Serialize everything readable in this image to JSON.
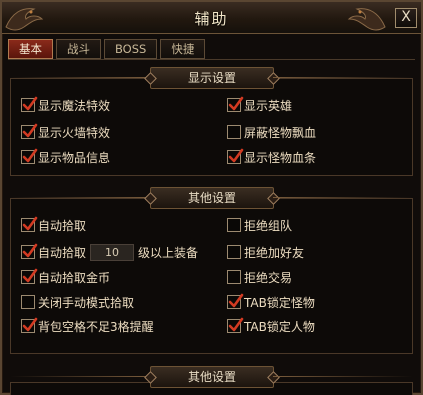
{
  "window": {
    "title": "辅助",
    "close_label": "X"
  },
  "tabs": [
    {
      "label": "基本",
      "active": true
    },
    {
      "label": "战斗",
      "active": false
    },
    {
      "label": "BOSS",
      "active": false
    },
    {
      "label": "快捷",
      "active": false
    }
  ],
  "display_settings": {
    "header": "显示设置",
    "options": [
      {
        "label": "显示魔法特效",
        "checked": true
      },
      {
        "label": "显示英雄",
        "checked": true
      },
      {
        "label": "显示火墙特效",
        "checked": true
      },
      {
        "label": "屏蔽怪物飘血",
        "checked": false
      },
      {
        "label": "显示物品信息",
        "checked": true
      },
      {
        "label": "显示怪物血条",
        "checked": true
      }
    ]
  },
  "other_settings": {
    "header": "其他设置",
    "options": [
      {
        "label": "自动拾取",
        "checked": true
      },
      {
        "label": "拒绝组队",
        "checked": false
      },
      {
        "label_before": "自动拾取",
        "level_value": "10",
        "label_after": "级以上装备",
        "checked": true
      },
      {
        "label": "拒绝加好友",
        "checked": false
      },
      {
        "label": "自动拾取金币",
        "checked": true
      },
      {
        "label": "拒绝交易",
        "checked": false
      },
      {
        "label": "关闭手动模式拾取",
        "checked": false
      },
      {
        "label": "TAB锁定怪物",
        "checked": true
      },
      {
        "label": "背包空格不足3格提醒",
        "checked": true
      },
      {
        "label": "TAB锁定人物",
        "checked": true
      }
    ]
  },
  "other_settings_2": {
    "header": "其他设置"
  },
  "colors": {
    "checkmark": "#d23a22",
    "active_tab": "#7a2214",
    "border": "#5a4632"
  }
}
